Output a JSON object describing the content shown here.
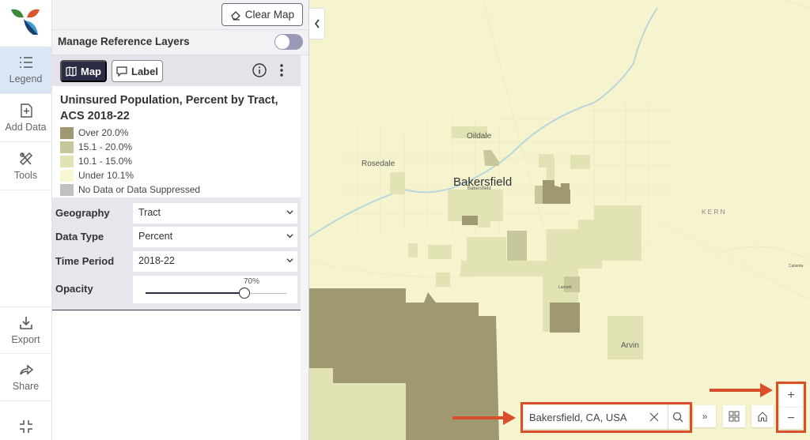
{
  "rail": {
    "items": [
      {
        "label": "Legend",
        "icon": "list-icon",
        "active": true
      },
      {
        "label": "Add Data",
        "icon": "add-file-icon"
      },
      {
        "label": "Tools",
        "icon": "tools-icon"
      },
      {
        "label": "Export",
        "icon": "download-icon"
      },
      {
        "label": "Share",
        "icon": "share-icon"
      },
      {
        "label": "",
        "icon": "collapse-icon"
      }
    ]
  },
  "panel": {
    "clear_map_label": "Clear Map",
    "manage_layers_label": "Manage Reference Layers",
    "manage_layers_on": false,
    "view_map_label": "Map",
    "view_label_label": "Label",
    "layer_title": "Uninsured Population, Percent by Tract, ACS 2018-22",
    "legend": [
      {
        "label": "Over 20.0%",
        "color": "#a09870"
      },
      {
        "label": "15.1 - 20.0%",
        "color": "#c6c79a"
      },
      {
        "label": "10.1 - 15.0%",
        "color": "#e2e3b4"
      },
      {
        "label": "Under 10.1%",
        "color": "#f8f7d4"
      },
      {
        "label": "No Data or Data Suppressed",
        "color": "#c0c0c0"
      }
    ],
    "controls": {
      "geography_label": "Geography",
      "geography_value": "Tract",
      "data_type_label": "Data Type",
      "data_type_value": "Percent",
      "time_period_label": "Time Period",
      "time_period_value": "2018-22",
      "opacity_label": "Opacity",
      "opacity_value": "70%",
      "opacity_fraction": 0.7
    }
  },
  "map": {
    "places": {
      "oildale": "Oildale",
      "rosedale": "Rosedale",
      "bakersfield": "Bakersfield",
      "bakersfield_small": "Bakersfield",
      "kern": "KERN",
      "lamont": "Lamont",
      "arvin": "Arvin",
      "caliente": "Caliente"
    },
    "search_value": "Bakersfield, CA, USA",
    "zoom_in_label": "+",
    "zoom_out_label": "−",
    "expand_label": "»"
  }
}
